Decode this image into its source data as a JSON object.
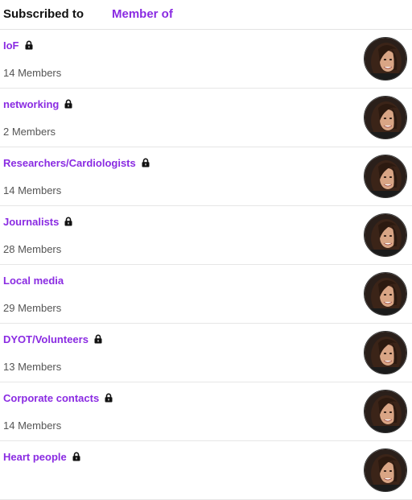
{
  "tabs": {
    "subscribed_label": "Subscribed to",
    "member_label": "Member of"
  },
  "colors": {
    "accent": "#8a2be2",
    "active_tab_text": "#111111",
    "muted_text": "#555555"
  },
  "groups": [
    {
      "name": "IoF",
      "members": "14 Members",
      "locked": true,
      "avatar_icon": "avatar-photo"
    },
    {
      "name": "networking",
      "members": "2 Members",
      "locked": true,
      "avatar_icon": "avatar-photo"
    },
    {
      "name": "Researchers/Cardiologists",
      "members": "14 Members",
      "locked": true,
      "avatar_icon": "avatar-photo"
    },
    {
      "name": "Journalists",
      "members": "28 Members",
      "locked": true,
      "avatar_icon": "avatar-photo"
    },
    {
      "name": "Local media",
      "members": "29 Members",
      "locked": false,
      "avatar_icon": "avatar-photo"
    },
    {
      "name": "DYOT/Volunteers",
      "members": "13 Members",
      "locked": true,
      "avatar_icon": "avatar-photo"
    },
    {
      "name": "Corporate contacts",
      "members": "14 Members",
      "locked": true,
      "avatar_icon": "avatar-photo"
    },
    {
      "name": "Heart people",
      "members": "",
      "locked": true,
      "avatar_icon": "avatar-photo"
    }
  ]
}
